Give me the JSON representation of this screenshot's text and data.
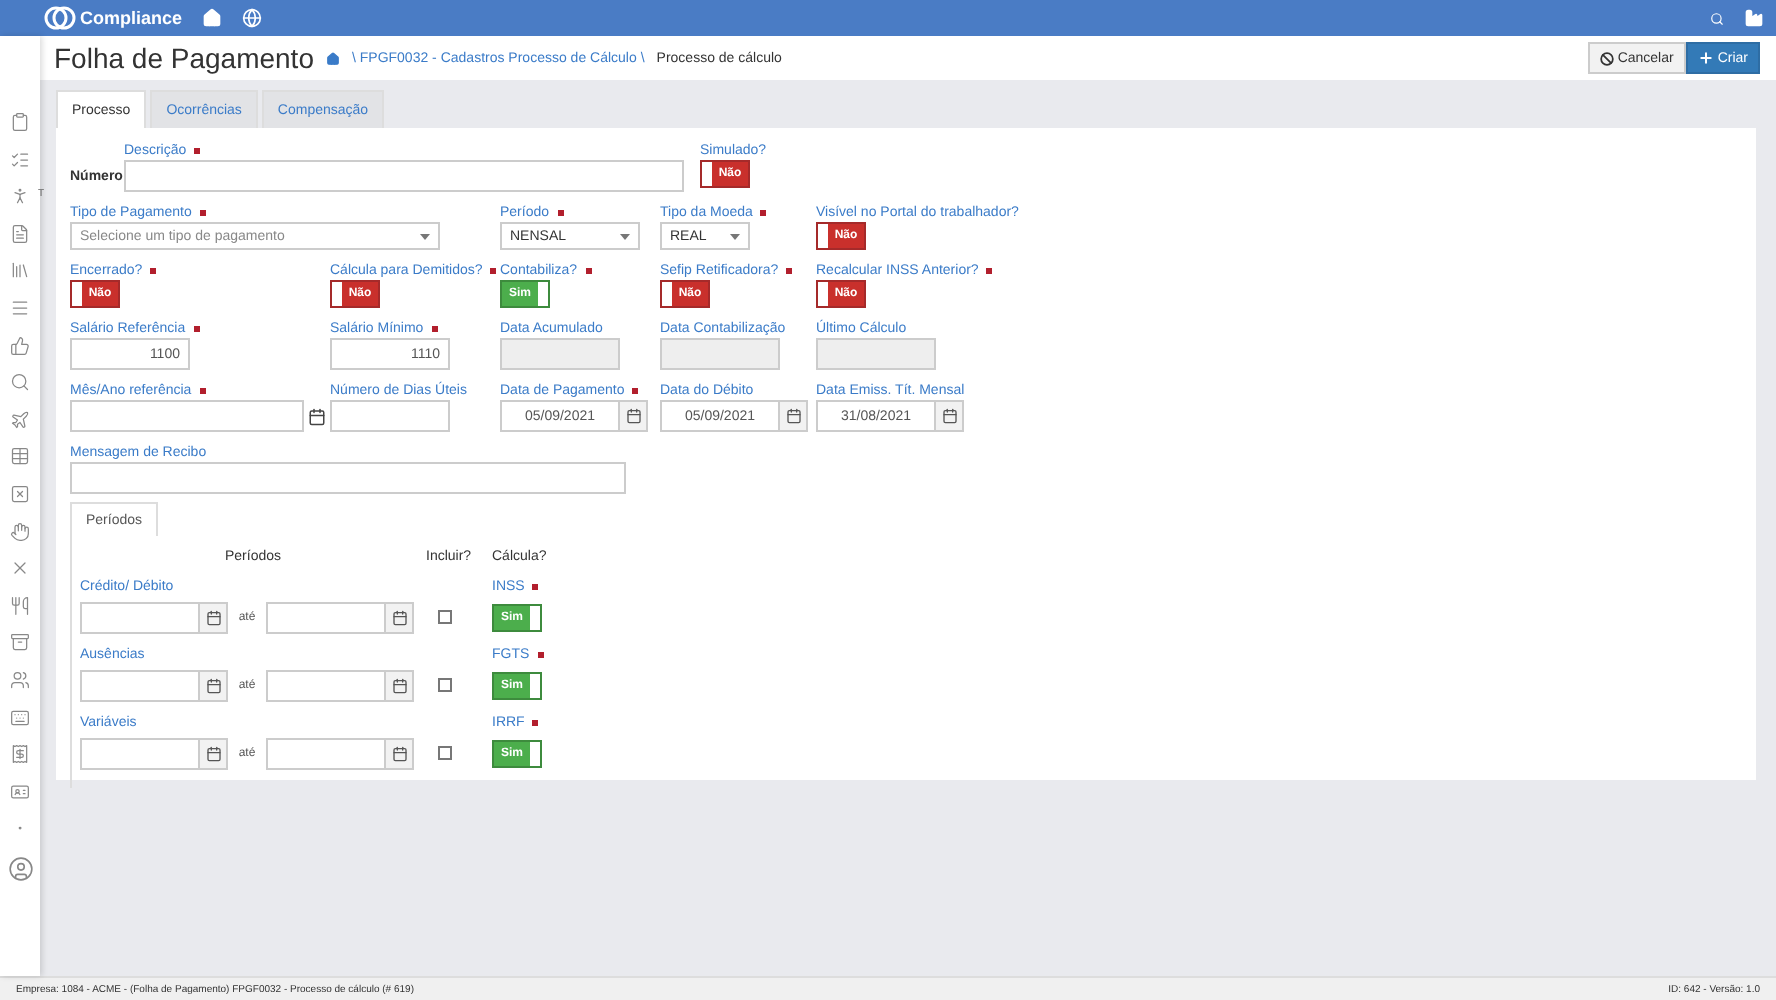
{
  "top_bar": {
    "logo": "Compliance"
  },
  "header": {
    "title": "Folha de Pagamento",
    "breadcrumb_link": "\\ FPGF0032 - Cadastros Processo de Cálculo \\",
    "breadcrumb_current": "Processo de cálculo",
    "buttons": [
      {
        "kind": "cancel",
        "label": "Cancelar"
      },
      {
        "kind": "create",
        "label": "Criar"
      }
    ]
  },
  "sidebar": {
    "cut_label": "T"
  },
  "tabs": [
    {
      "label": "Processo",
      "selected": true
    },
    {
      "label": "Ocorrências",
      "selected": false
    },
    {
      "label": "Compensação",
      "selected": false
    }
  ],
  "form": {
    "number_label": "Número",
    "description": {
      "label": "Descrição",
      "required": true
    },
    "simulated": {
      "label": "Simulado?",
      "toggle": {
        "on": false,
        "text": "Não"
      }
    },
    "fields": [
      {
        "kind": "select",
        "label": "Tipo de Pagamento",
        "required": true,
        "placeholder": "Selecione um tipo de pagamento"
      },
      {
        "kind": "select",
        "label": "Período",
        "required": true,
        "value": "NENSAL"
      },
      {
        "kind": "select",
        "label": "Tipo da Moeda",
        "required": true,
        "value": "REAL"
      },
      {
        "kind": "toggle",
        "label": "Visível no Portal do trabalhador?",
        "required": false,
        "on": false,
        "text": "Não"
      },
      {
        "kind": "toggle",
        "label": "Encerrado?",
        "required": true,
        "on": false,
        "text": "Não"
      },
      {
        "kind": "toggle",
        "label": "Cálcula para Demitidos?",
        "required": true,
        "on": false,
        "text": "Não"
      },
      {
        "kind": "toggle",
        "label": "Contabiliza?",
        "required": true,
        "on": true,
        "text": "Sim"
      },
      {
        "kind": "toggle",
        "label": "Sefip Retificadora?",
        "required": true,
        "on": false,
        "text": "Não"
      },
      {
        "kind": "toggle",
        "label": "Recalcular INSS Anterior?",
        "required": true,
        "on": false,
        "text": "Não"
      },
      {
        "kind": "number",
        "label": "Salário Referência",
        "required": true,
        "value": "1100"
      },
      {
        "kind": "number",
        "label": "Salário Mínimo",
        "required": true,
        "value": "1110"
      },
      {
        "kind": "readonly",
        "label": "Data Acumulado",
        "required": false
      },
      {
        "kind": "readonly",
        "label": "Data Contabilização",
        "required": false
      },
      {
        "kind": "readonly",
        "label": "Último Cálculo",
        "required": false
      },
      {
        "kind": "month",
        "label": "Mês/Ano referência",
        "required": true
      },
      {
        "kind": "number",
        "label": "Número de Dias Úteis",
        "required": false
      },
      {
        "kind": "date",
        "label": "Data de Pagamento",
        "required": true,
        "value": "05/09/2021"
      },
      {
        "kind": "date",
        "label": "Data do Débito",
        "required": false,
        "value": "05/09/2021"
      },
      {
        "kind": "date",
        "label": "Data Emiss. Tít. Mensal",
        "required": false,
        "value": "31/08/2021"
      },
      {
        "kind": "wide",
        "label": "Mensagem de Recibo",
        "required": false
      }
    ]
  },
  "periods": {
    "tab": "Períodos",
    "headers": [
      "Períodos",
      "Incluir?",
      "Cálcula?"
    ],
    "rows": [
      {
        "label": "Crédito/ Débito",
        "until": "até",
        "included": false,
        "calc_label": "INSS",
        "calc_required": true,
        "calc": {
          "on": true,
          "text": "Sim"
        }
      },
      {
        "label": "Ausências",
        "until": "até",
        "included": false,
        "calc_label": "FGTS",
        "calc_required": true,
        "calc": {
          "on": true,
          "text": "Sim"
        }
      },
      {
        "label": "Variáveis",
        "until": "até",
        "included": false,
        "calc_label": "IRRF",
        "calc_required": true,
        "calc": {
          "on": true,
          "text": "Sim"
        }
      }
    ]
  },
  "status_bar": {
    "left": "Empresa: 1084 - ACME - (Folha de Pagamento) FPGF0032 - Processo de cálculo (# 619)",
    "right": "ID: 642 - Versão: 1.0"
  }
}
